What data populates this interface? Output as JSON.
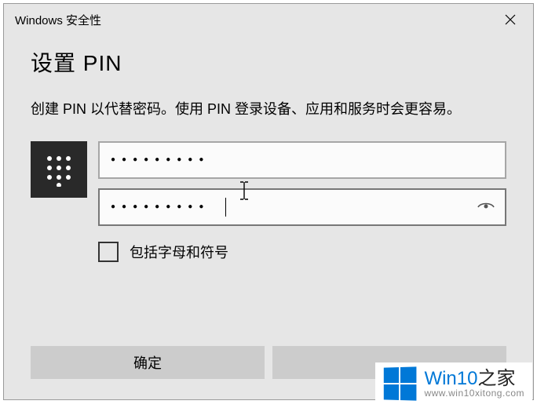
{
  "titlebar": {
    "text": "Windows 安全性"
  },
  "heading": "设置 PIN",
  "description": "创建 PIN 以代替密码。使用 PIN 登录设备、应用和服务时会更容易。",
  "fields": {
    "pin_value": "●●●●●●●●●",
    "confirm_value": "●●●●●●●●●"
  },
  "checkbox": {
    "label": "包括字母和符号",
    "checked": false
  },
  "buttons": {
    "ok": "确定",
    "cancel": ""
  },
  "watermark": {
    "brand_prefix": "Win10",
    "brand_suffix": "之家",
    "url": "www.win10xitong.com"
  }
}
